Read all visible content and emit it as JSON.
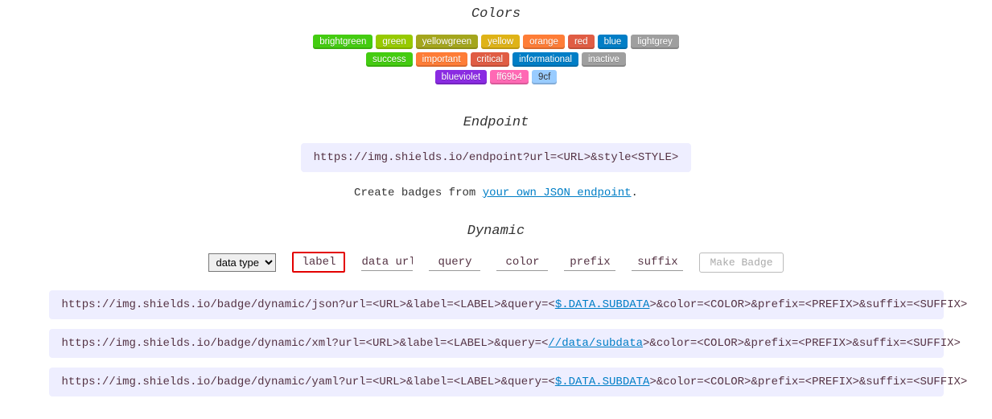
{
  "colors": {
    "heading": "Colors",
    "row1": [
      "brightgreen",
      "green",
      "yellowgreen",
      "yellow",
      "orange",
      "red",
      "blue",
      "lightgrey"
    ],
    "row2": [
      "success",
      "important",
      "critical",
      "informational",
      "inactive"
    ],
    "row3": [
      "blueviolet",
      "ff69b4",
      "9cf"
    ]
  },
  "endpoint": {
    "heading": "Endpoint",
    "url_template": "https://img.shields.io/endpoint?url=<URL>&style<STYLE>",
    "helper_pre": "Create badges from ",
    "helper_link": "your own JSON endpoint",
    "helper_post": "."
  },
  "dynamic": {
    "heading": "Dynamic",
    "select": {
      "value": "data type"
    },
    "fields": {
      "label": "label",
      "data_url": "data url",
      "query": "query",
      "color": "color",
      "prefix": "prefix",
      "suffix": "suffix"
    },
    "make_button": "Make Badge",
    "templates": {
      "json": {
        "pre": "https://img.shields.io/badge/dynamic/json?url=<URL>&label=<LABEL>&query=<",
        "link": "$.DATA.SUBDATA",
        "post": ">&color=<COLOR>&prefix=<PREFIX>&suffix=<SUFFIX>"
      },
      "xml": {
        "pre": "https://img.shields.io/badge/dynamic/xml?url=<URL>&label=<LABEL>&query=<",
        "link": "//data/subdata",
        "post": ">&color=<COLOR>&prefix=<PREFIX>&suffix=<SUFFIX>"
      },
      "yaml": {
        "pre": "https://img.shields.io/badge/dynamic/yaml?url=<URL>&label=<LABEL>&query=<",
        "link": "$.DATA.SUBDATA",
        "post": ">&color=<COLOR>&prefix=<PREFIX>&suffix=<SUFFIX>"
      }
    }
  }
}
